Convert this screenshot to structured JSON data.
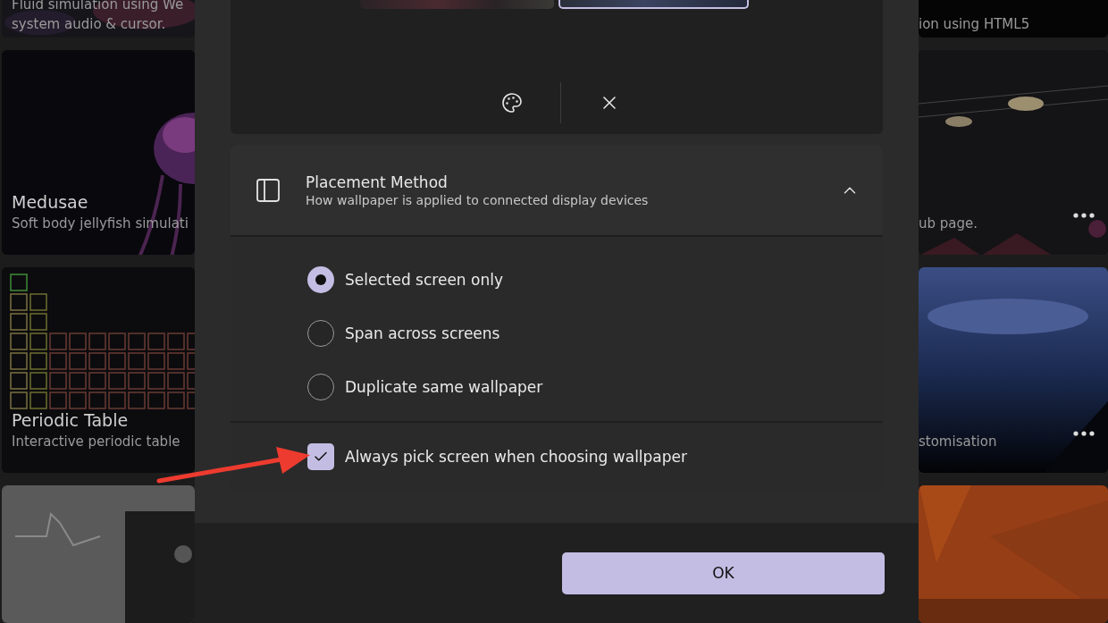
{
  "gallery": {
    "left": [
      {
        "description_lines": [
          "Fluid simulation using We",
          "system audio & cursor."
        ],
        "menu_button": false
      },
      {
        "title": "Medusae",
        "description_lines": [
          "Soft body jellyfish simulati"
        ],
        "menu_button": false
      },
      {
        "title": "Periodic Table",
        "description_lines": [
          "Interactive periodic table"
        ],
        "menu_button": false
      },
      {
        "menu_button": false
      }
    ],
    "right": [
      {
        "description_lines": [
          "ion using HTML5"
        ],
        "menu_button": false
      },
      {
        "description_lines": [
          "ub page."
        ],
        "menu_button": true
      },
      {
        "description_lines": [
          "stomisation"
        ],
        "menu_button": true
      },
      {
        "menu_button": false
      }
    ]
  },
  "dialog": {
    "screens": [
      {
        "selected": false
      },
      {
        "selected": true
      }
    ],
    "placement": {
      "title": "Placement Method",
      "subtitle": "How wallpaper is applied to connected display devices",
      "expanded": true,
      "options": [
        {
          "label": "Selected screen only",
          "selected": true
        },
        {
          "label": "Span across screens",
          "selected": false
        },
        {
          "label": "Duplicate same wallpaper",
          "selected": false
        }
      ],
      "always_pick": {
        "label": "Always pick screen when choosing wallpaper",
        "checked": true
      }
    },
    "ok_button": "OK"
  }
}
